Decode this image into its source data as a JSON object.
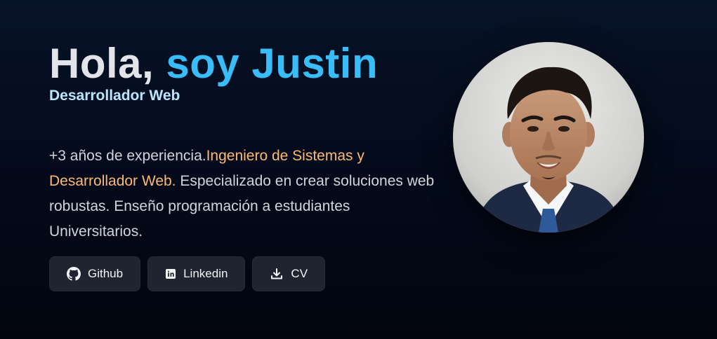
{
  "hero": {
    "title_prefix": "Hola, ",
    "title_name": "soy Justin",
    "subtitle": "Desarrollador Web"
  },
  "bio": {
    "part1": "+3 años de experiencia.",
    "highlight": "Ingeniero de Sistemas y Desarrollador Web.",
    "part2": " Especializado en crear soluciones web robustas. Enseño programación a estudiantes Universitarios."
  },
  "actions": {
    "github_label": "Github",
    "linkedin_label": "Linkedin",
    "cv_label": "CV"
  },
  "icons": {
    "github": "github-icon",
    "linkedin": "linkedin-icon",
    "download": "download-icon"
  },
  "colors": {
    "accent": "#38bdf8",
    "highlight": "#fdba74",
    "subtitle": "#bae6fd",
    "button_bg": "#1f2430"
  }
}
